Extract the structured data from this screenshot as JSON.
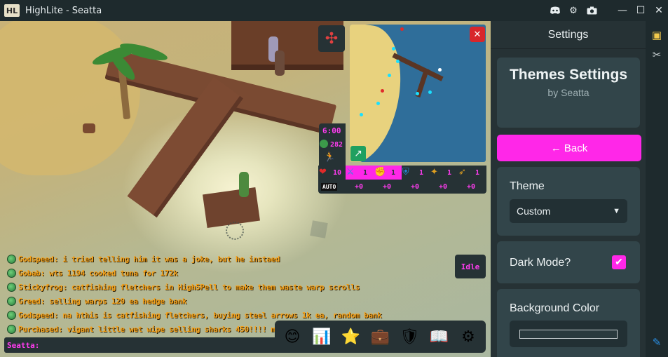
{
  "window": {
    "logo_text": "HL",
    "title": "HighLite - Seatta",
    "controls": {
      "minimize": "—",
      "maximize": "☐",
      "close": "✕"
    }
  },
  "titlebar_icons": [
    "discord-icon",
    "gear-icon",
    "camera-icon"
  ],
  "hud": {
    "time": "6:00",
    "gp": "282",
    "auto_label": "AUTO",
    "hitpoints": "10",
    "combat_stats": [
      {
        "icon": "crossed-swords-icon",
        "glyph": "⚔",
        "level": "1",
        "bonus": "+0"
      },
      {
        "icon": "fist-icon",
        "glyph": "✊",
        "level": "1",
        "bonus": "+0"
      },
      {
        "icon": "shield-icon",
        "glyph": "⛨",
        "level": "1",
        "bonus": "+0"
      },
      {
        "icon": "magic-wand-icon",
        "glyph": "✦",
        "level": "1",
        "bonus": "+0"
      },
      {
        "icon": "bow-icon",
        "glyph": "➶",
        "level": "1",
        "bonus": "+0"
      }
    ],
    "idle_status": "Idle"
  },
  "chat": {
    "messages": [
      "Godspeed: i tried telling him it was a joke, but he instaed",
      "Gobab: wts 1194 cooked tuna for 172k",
      "Stickyfrog: catfishing fletchers in High5Pell to make them waste warp scrolls",
      "Greed: selling warps 120 ea hedge bank",
      "Godspeed: na hthis is catfishing fletchers, buying steel arrows 1k ea, random bank",
      "Purchased: vigant little wet wipe selling sharks 450!!!! mofo :P"
    ],
    "input_prompt": "Seatta:"
  },
  "toolbar": [
    {
      "name": "emotes-icon",
      "glyph": "😊"
    },
    {
      "name": "stats-icon",
      "glyph": "📊"
    },
    {
      "name": "quests-icon",
      "glyph": "⭐"
    },
    {
      "name": "inventory-icon",
      "glyph": "💼"
    },
    {
      "name": "equipment-icon",
      "glyph": "🛡"
    },
    {
      "name": "spellbook-icon",
      "glyph": "📖"
    },
    {
      "name": "settings-icon",
      "glyph": "⚙"
    }
  ],
  "settings": {
    "header": "Settings",
    "card_title": "Themes Settings",
    "card_sub": "by Seatta",
    "back_label": "← Back",
    "theme_label": "Theme",
    "theme_value": "Custom",
    "dark_mode_label": "Dark Mode?",
    "dark_mode_checked": true,
    "bg_color_label": "Background Color"
  },
  "colors": {
    "accent": "#ff27e8",
    "panel_bg": "#263235",
    "card_bg": "#32454a",
    "chat_text": "#f6a21a"
  }
}
